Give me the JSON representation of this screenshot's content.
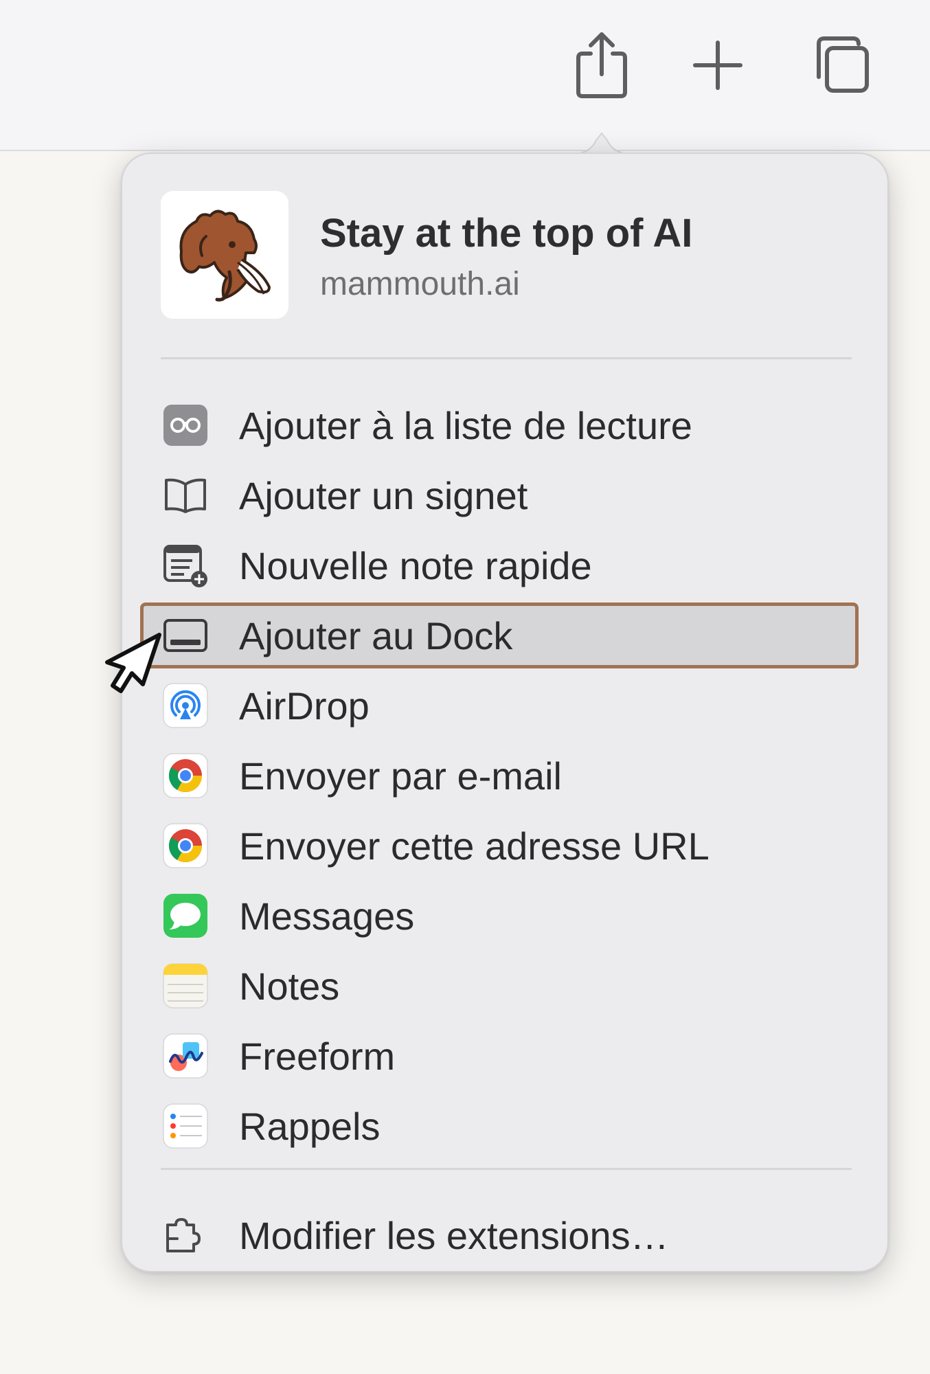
{
  "toolbar": {
    "buttons": [
      {
        "name": "share",
        "icon": "share-icon"
      },
      {
        "name": "new-tab",
        "icon": "plus-icon"
      },
      {
        "name": "tab-overview",
        "icon": "tabs-icon"
      }
    ]
  },
  "share_sheet": {
    "site": {
      "title": "Stay at the top of AI",
      "domain": "mammouth.ai",
      "thumbnail_icon": "mammoth-icon"
    },
    "items": [
      {
        "label": "Ajouter à la liste de lecture",
        "icon": "reading-list-icon"
      },
      {
        "label": "Ajouter un signet",
        "icon": "bookmark-book-icon"
      },
      {
        "label": "Nouvelle note rapide",
        "icon": "quick-note-icon"
      },
      {
        "label": "Ajouter au Dock",
        "icon": "dock-icon",
        "highlighted": true
      },
      {
        "label": "AirDrop",
        "icon": "airdrop-icon"
      },
      {
        "label": "Envoyer par e-mail",
        "icon": "chrome-icon"
      },
      {
        "label": "Envoyer cette adresse URL",
        "icon": "chrome-icon"
      },
      {
        "label": "Messages",
        "icon": "messages-icon"
      },
      {
        "label": "Notes",
        "icon": "notes-icon"
      },
      {
        "label": "Freeform",
        "icon": "freeform-icon"
      },
      {
        "label": "Rappels",
        "icon": "reminders-icon"
      }
    ],
    "footer": {
      "label": "Modifier les extensions…",
      "icon": "extensions-icon"
    }
  },
  "colors": {
    "highlight_border": "#a07352",
    "highlight_fill": "#d6d6d9",
    "popover_bg": "#ececee",
    "text": "#2b2b2d"
  }
}
